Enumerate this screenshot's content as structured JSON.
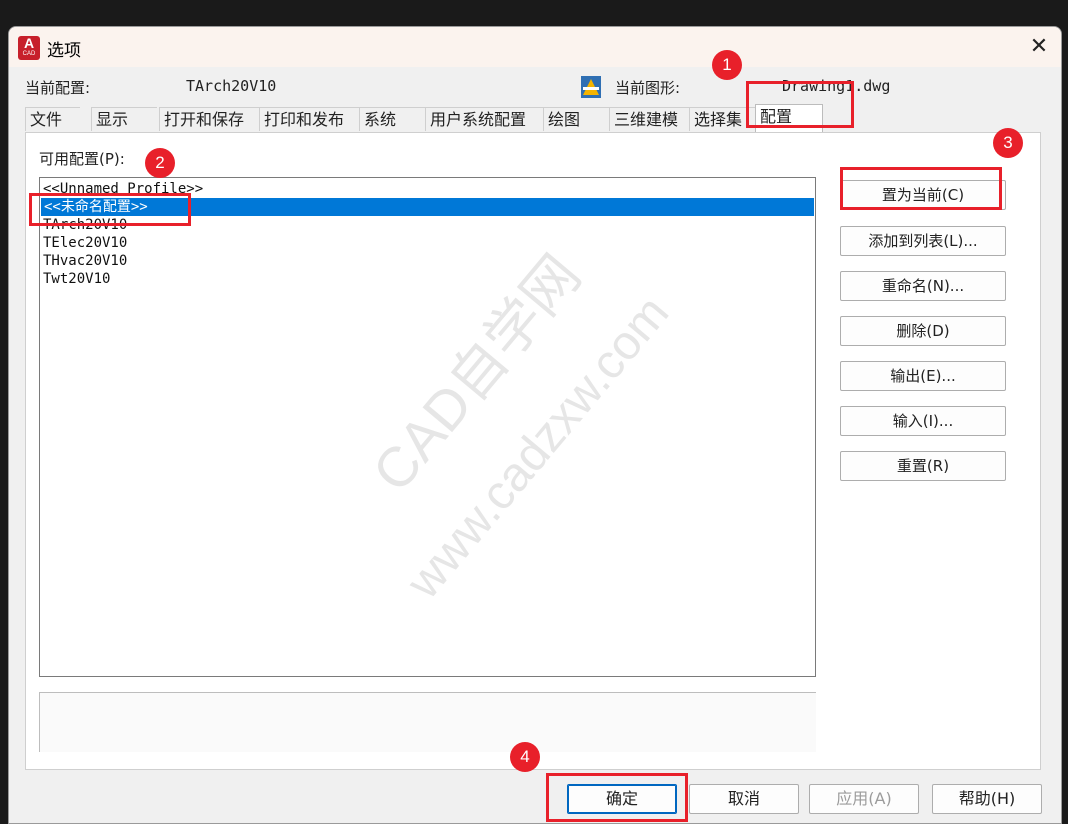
{
  "window": {
    "title": "选项",
    "icon_text": "A",
    "icon_subtext": "CAD",
    "close_glyph": "✕"
  },
  "header": {
    "current_profile_label": "当前配置:",
    "current_profile_value": "TArch20V10",
    "current_drawing_label": "当前图形:",
    "current_drawing_value": "Drawing1.dwg"
  },
  "tabs": [
    {
      "label": "文件"
    },
    {
      "label": "显示"
    },
    {
      "label": "打开和保存"
    },
    {
      "label": "打印和发布"
    },
    {
      "label": "系统"
    },
    {
      "label": "用户系统配置"
    },
    {
      "label": "绘图"
    },
    {
      "label": "三维建模"
    },
    {
      "label": "选择集"
    },
    {
      "label": "配置"
    }
  ],
  "active_tab": "配置",
  "profiles": {
    "label": "可用配置(P):",
    "items": [
      "<<Unnamed Profile>>",
      "<<未命名配置>>",
      "TArch20V10",
      "TElec20V10",
      "THvac20V10",
      "Twt20V10"
    ],
    "selected": "<<未命名配置>>"
  },
  "buttons": {
    "set_current": "置为当前(C)",
    "add_to_list": "添加到列表(L)...",
    "rename": "重命名(N)...",
    "delete": "删除(D)",
    "export": "输出(E)...",
    "import": "输入(I)...",
    "reset": "重置(R)"
  },
  "footer": {
    "ok": "确定",
    "cancel": "取消",
    "apply": "应用(A)",
    "help": "帮助(H)"
  },
  "annotations": {
    "badge1": "1",
    "badge2": "2",
    "badge3": "3",
    "badge4": "4",
    "color": "#e8202a"
  },
  "watermark": {
    "line1": "CAD自学网",
    "line2": "www.cadzxw.com"
  },
  "colors": {
    "selection": "#0078d7",
    "annotation": "#e8202a",
    "title_bg": "#fbf3ee"
  }
}
